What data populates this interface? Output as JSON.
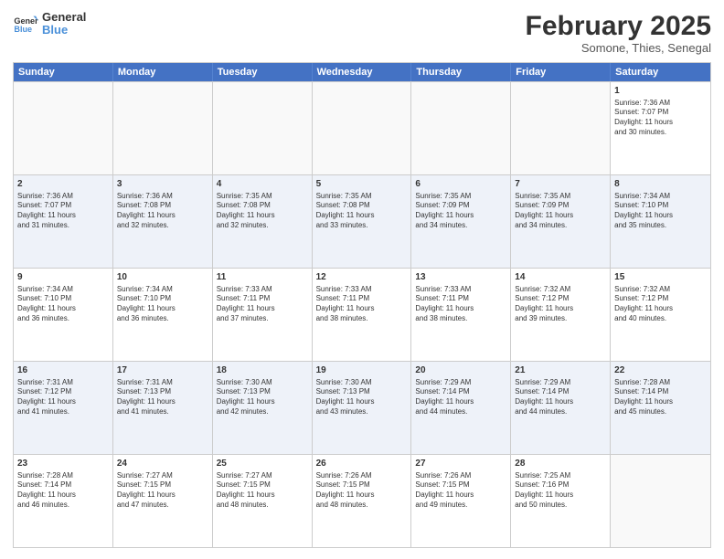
{
  "header": {
    "logo_general": "General",
    "logo_blue": "Blue",
    "month_title": "February 2025",
    "location": "Somone, Thies, Senegal"
  },
  "days_of_week": [
    "Sunday",
    "Monday",
    "Tuesday",
    "Wednesday",
    "Thursday",
    "Friday",
    "Saturday"
  ],
  "weeks": [
    {
      "alt": false,
      "cells": [
        {
          "day": "",
          "text": ""
        },
        {
          "day": "",
          "text": ""
        },
        {
          "day": "",
          "text": ""
        },
        {
          "day": "",
          "text": ""
        },
        {
          "day": "",
          "text": ""
        },
        {
          "day": "",
          "text": ""
        },
        {
          "day": "1",
          "text": "Sunrise: 7:36 AM\nSunset: 7:07 PM\nDaylight: 11 hours\nand 30 minutes."
        }
      ]
    },
    {
      "alt": true,
      "cells": [
        {
          "day": "2",
          "text": "Sunrise: 7:36 AM\nSunset: 7:07 PM\nDaylight: 11 hours\nand 31 minutes."
        },
        {
          "day": "3",
          "text": "Sunrise: 7:36 AM\nSunset: 7:08 PM\nDaylight: 11 hours\nand 32 minutes."
        },
        {
          "day": "4",
          "text": "Sunrise: 7:35 AM\nSunset: 7:08 PM\nDaylight: 11 hours\nand 32 minutes."
        },
        {
          "day": "5",
          "text": "Sunrise: 7:35 AM\nSunset: 7:08 PM\nDaylight: 11 hours\nand 33 minutes."
        },
        {
          "day": "6",
          "text": "Sunrise: 7:35 AM\nSunset: 7:09 PM\nDaylight: 11 hours\nand 34 minutes."
        },
        {
          "day": "7",
          "text": "Sunrise: 7:35 AM\nSunset: 7:09 PM\nDaylight: 11 hours\nand 34 minutes."
        },
        {
          "day": "8",
          "text": "Sunrise: 7:34 AM\nSunset: 7:10 PM\nDaylight: 11 hours\nand 35 minutes."
        }
      ]
    },
    {
      "alt": false,
      "cells": [
        {
          "day": "9",
          "text": "Sunrise: 7:34 AM\nSunset: 7:10 PM\nDaylight: 11 hours\nand 36 minutes."
        },
        {
          "day": "10",
          "text": "Sunrise: 7:34 AM\nSunset: 7:10 PM\nDaylight: 11 hours\nand 36 minutes."
        },
        {
          "day": "11",
          "text": "Sunrise: 7:33 AM\nSunset: 7:11 PM\nDaylight: 11 hours\nand 37 minutes."
        },
        {
          "day": "12",
          "text": "Sunrise: 7:33 AM\nSunset: 7:11 PM\nDaylight: 11 hours\nand 38 minutes."
        },
        {
          "day": "13",
          "text": "Sunrise: 7:33 AM\nSunset: 7:11 PM\nDaylight: 11 hours\nand 38 minutes."
        },
        {
          "day": "14",
          "text": "Sunrise: 7:32 AM\nSunset: 7:12 PM\nDaylight: 11 hours\nand 39 minutes."
        },
        {
          "day": "15",
          "text": "Sunrise: 7:32 AM\nSunset: 7:12 PM\nDaylight: 11 hours\nand 40 minutes."
        }
      ]
    },
    {
      "alt": true,
      "cells": [
        {
          "day": "16",
          "text": "Sunrise: 7:31 AM\nSunset: 7:12 PM\nDaylight: 11 hours\nand 41 minutes."
        },
        {
          "day": "17",
          "text": "Sunrise: 7:31 AM\nSunset: 7:13 PM\nDaylight: 11 hours\nand 41 minutes."
        },
        {
          "day": "18",
          "text": "Sunrise: 7:30 AM\nSunset: 7:13 PM\nDaylight: 11 hours\nand 42 minutes."
        },
        {
          "day": "19",
          "text": "Sunrise: 7:30 AM\nSunset: 7:13 PM\nDaylight: 11 hours\nand 43 minutes."
        },
        {
          "day": "20",
          "text": "Sunrise: 7:29 AM\nSunset: 7:14 PM\nDaylight: 11 hours\nand 44 minutes."
        },
        {
          "day": "21",
          "text": "Sunrise: 7:29 AM\nSunset: 7:14 PM\nDaylight: 11 hours\nand 44 minutes."
        },
        {
          "day": "22",
          "text": "Sunrise: 7:28 AM\nSunset: 7:14 PM\nDaylight: 11 hours\nand 45 minutes."
        }
      ]
    },
    {
      "alt": false,
      "cells": [
        {
          "day": "23",
          "text": "Sunrise: 7:28 AM\nSunset: 7:14 PM\nDaylight: 11 hours\nand 46 minutes."
        },
        {
          "day": "24",
          "text": "Sunrise: 7:27 AM\nSunset: 7:15 PM\nDaylight: 11 hours\nand 47 minutes."
        },
        {
          "day": "25",
          "text": "Sunrise: 7:27 AM\nSunset: 7:15 PM\nDaylight: 11 hours\nand 48 minutes."
        },
        {
          "day": "26",
          "text": "Sunrise: 7:26 AM\nSunset: 7:15 PM\nDaylight: 11 hours\nand 48 minutes."
        },
        {
          "day": "27",
          "text": "Sunrise: 7:26 AM\nSunset: 7:15 PM\nDaylight: 11 hours\nand 49 minutes."
        },
        {
          "day": "28",
          "text": "Sunrise: 7:25 AM\nSunset: 7:16 PM\nDaylight: 11 hours\nand 50 minutes."
        },
        {
          "day": "",
          "text": ""
        }
      ]
    }
  ]
}
